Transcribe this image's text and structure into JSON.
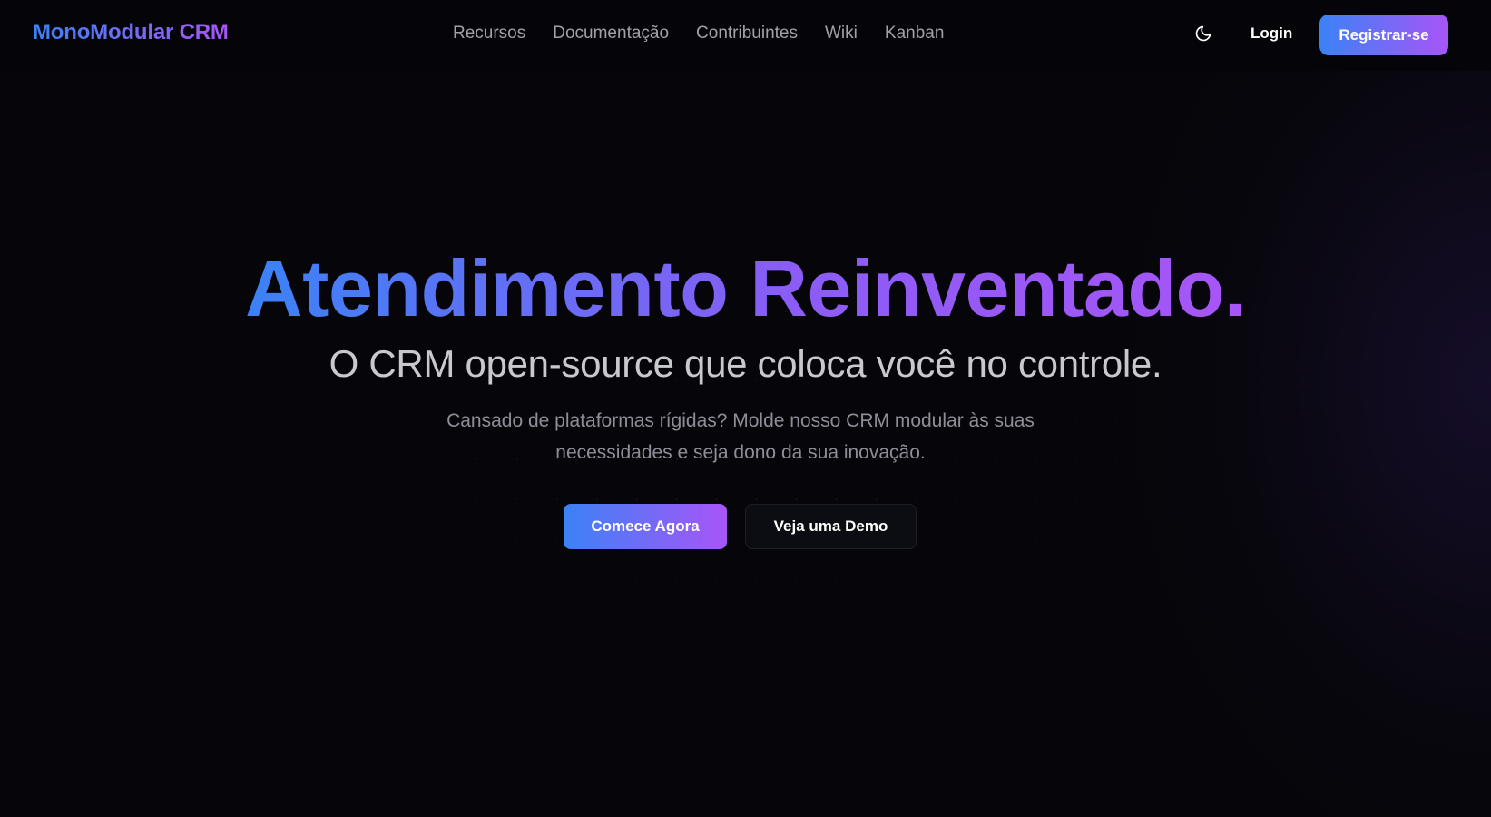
{
  "header": {
    "brand": "MonoModular CRM",
    "nav": [
      {
        "label": "Recursos"
      },
      {
        "label": "Documentação"
      },
      {
        "label": "Contribuintes"
      },
      {
        "label": "Wiki"
      },
      {
        "label": "Kanban"
      }
    ],
    "theme_toggle_icon": "moon-icon",
    "login_label": "Login",
    "register_label": "Registrar-se"
  },
  "hero": {
    "title": "Atendimento Reinventado.",
    "subtitle": "O CRM open-source que coloca você no controle.",
    "description": "Cansado de plataformas rígidas? Molde nosso CRM modular às suas necessidades e seja dono da sua inovação.",
    "primary_cta": "Comece Agora",
    "secondary_cta": "Veja uma Demo"
  },
  "colors": {
    "gradient_start": "#3b82f6",
    "gradient_end": "#a855f7",
    "background": "#06060a",
    "nav_text": "#a1a1aa"
  }
}
